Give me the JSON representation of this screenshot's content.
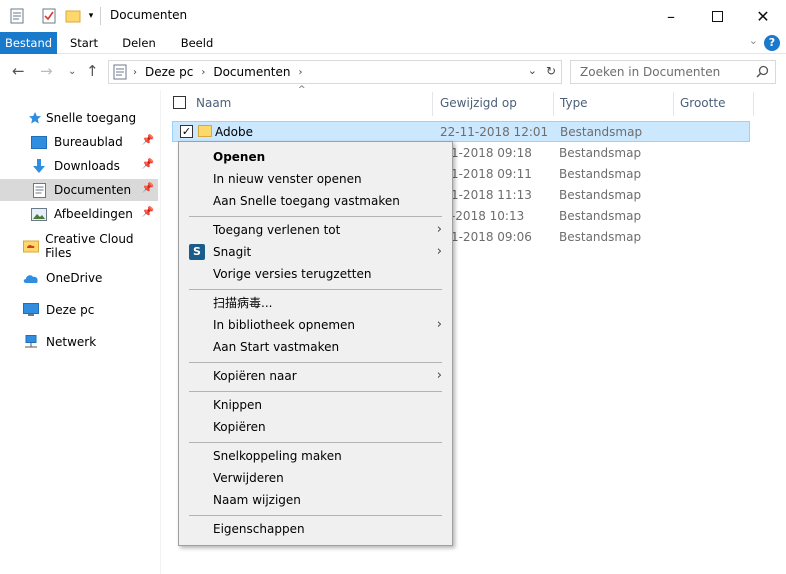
{
  "window": {
    "title": "Documenten"
  },
  "ribbon": {
    "tabs": [
      "Bestand",
      "Start",
      "Delen",
      "Beeld"
    ],
    "help": "?"
  },
  "address": {
    "crumbs": [
      "Deze pc",
      "Documenten"
    ]
  },
  "search": {
    "placeholder": "Zoeken in Documenten"
  },
  "sidebar": {
    "quick_access": "Snelle toegang",
    "items": [
      "Bureaublad",
      "Downloads",
      "Documenten",
      "Afbeeldingen"
    ],
    "creative_cloud": "Creative Cloud Files",
    "onedrive": "OneDrive",
    "thispc": "Deze pc",
    "network": "Netwerk"
  },
  "columns": {
    "name": "Naam",
    "date": "Gewijzigd op",
    "type": "Type",
    "size": "Grootte"
  },
  "rows": [
    {
      "name": "Adobe",
      "date": "22-11-2018 12:01",
      "type": "Bestandsmap"
    },
    {
      "date": "-11-2018 09:18",
      "type": "Bestandsmap"
    },
    {
      "date": "-11-2018 09:11",
      "type": "Bestandsmap"
    },
    {
      "date": "-11-2018 11:13",
      "type": "Bestandsmap"
    },
    {
      "date": "-9-2018 10:13",
      "type": "Bestandsmap"
    },
    {
      "date": "-11-2018 09:06",
      "type": "Bestandsmap"
    }
  ],
  "context_menu": {
    "open": "Openen",
    "open_new": "In nieuw venster openen",
    "pin_quick": "Aan Snelle toegang vastmaken",
    "give_access": "Toegang verlenen tot",
    "snagit": "Snagit",
    "snagit_icon": "S",
    "restore_versions": "Vorige versies terugzetten",
    "scan": "扫描病毒...",
    "include_library": "In bibliotheek opnemen",
    "pin_start": "Aan Start vastmaken",
    "send_to": "Kopiëren naar",
    "cut": "Knippen",
    "copy": "Kopiëren",
    "shortcut": "Snelkoppeling maken",
    "delete": "Verwijderen",
    "rename": "Naam wijzigen",
    "properties": "Eigenschappen"
  },
  "colors": {
    "accent": "#1979ca",
    "selection": "#cce8ff",
    "folder": "#ffd86b"
  }
}
